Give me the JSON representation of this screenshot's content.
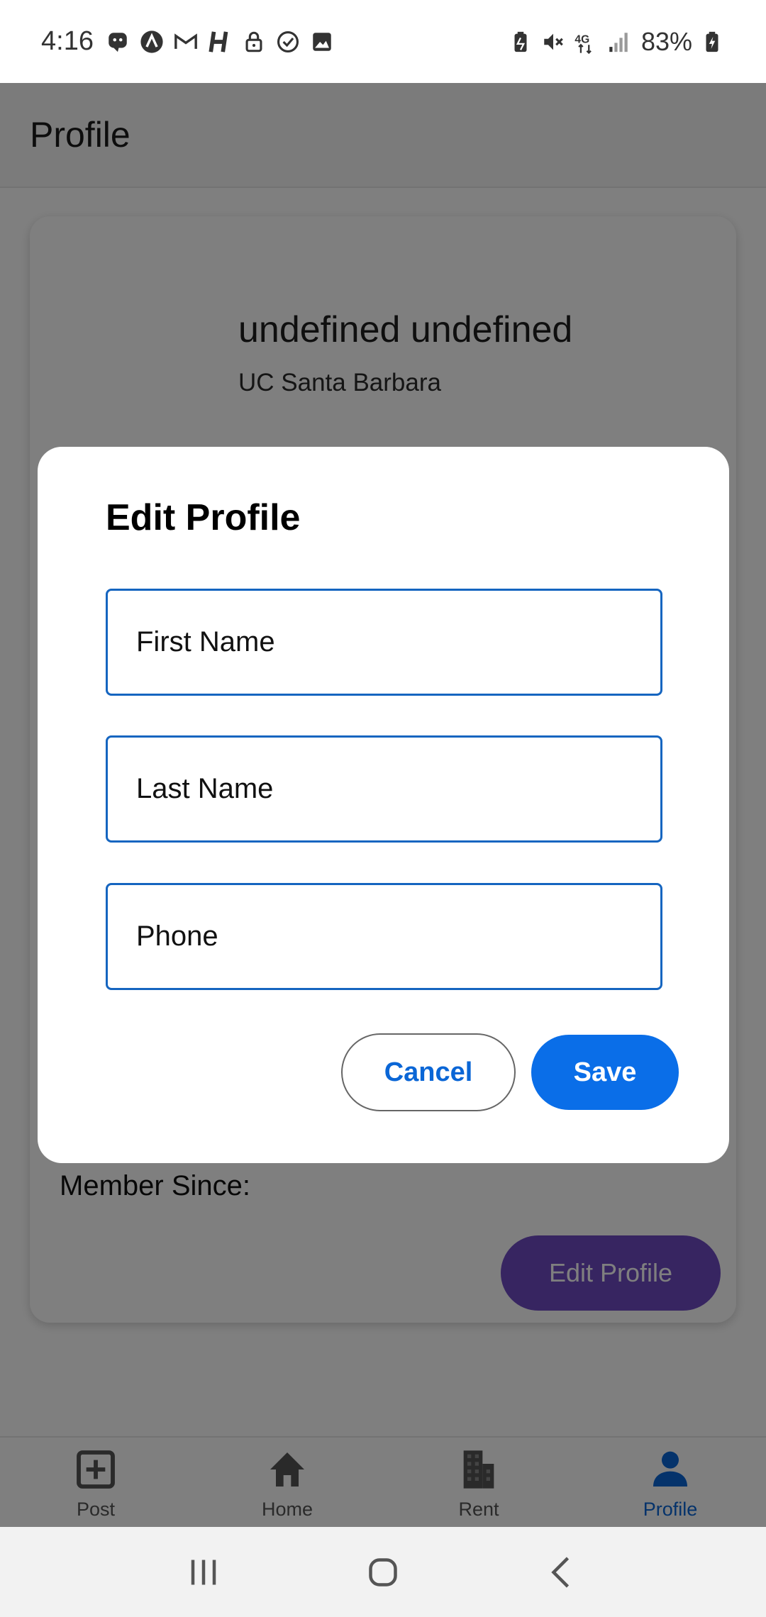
{
  "status_bar": {
    "time": "4:16",
    "battery_percent": "83%",
    "left_icons": [
      "chat-bot-icon",
      "arrow-circle-icon",
      "gmail-icon",
      "h-app-icon",
      "lock-icon",
      "check-circle-icon",
      "image-icon"
    ],
    "right_icons": [
      "battery-saver-icon",
      "mute-icon",
      "4g-icon",
      "signal-icon",
      "battery-charging-icon"
    ]
  },
  "header": {
    "title": "Profile"
  },
  "profile": {
    "name": "undefined undefined",
    "school": "UC Santa Barbara",
    "member_since_label": "Member Since:",
    "edit_button_label": "Edit Profile"
  },
  "dialog": {
    "title": "Edit Profile",
    "first_name_placeholder": "First Name",
    "last_name_placeholder": "Last Name",
    "phone_placeholder": "Phone",
    "cancel_label": "Cancel",
    "save_label": "Save"
  },
  "bottom_nav": {
    "items": [
      {
        "label": "Post",
        "icon": "add-box-icon",
        "active": false
      },
      {
        "label": "Home",
        "icon": "home-icon",
        "active": false
      },
      {
        "label": "Rent",
        "icon": "building-icon",
        "active": false
      },
      {
        "label": "Profile",
        "icon": "person-icon",
        "active": true
      }
    ]
  },
  "colors": {
    "accent_blue": "#0a6ee8",
    "field_border": "#1565c0",
    "edit_profile_purple": "#6f4bc3",
    "active_nav": "#0a66d6"
  }
}
